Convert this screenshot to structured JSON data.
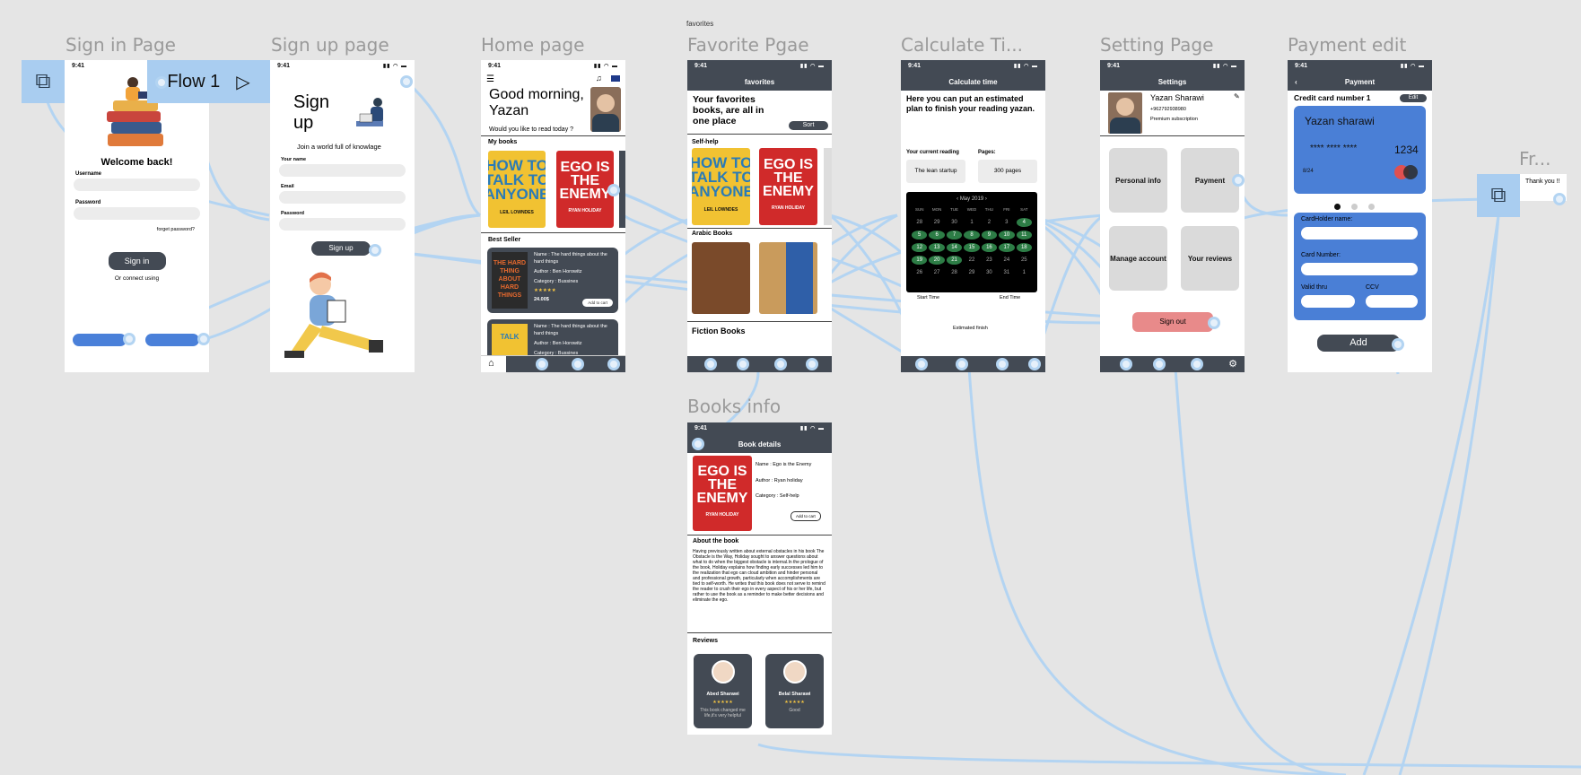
{
  "canvas": {
    "top_label": "favorites",
    "flow_name": "Flow 1"
  },
  "frames": {
    "signin": "Sign in Page",
    "signup": "Sign up page",
    "home": "Home page",
    "favorite": "Favorite Pgae",
    "calculate": "Calculate Ti...",
    "settings": "Setting Page",
    "payment": "Payment edit",
    "books_info": "Books info",
    "fr": "Fr..."
  },
  "status_time": "9:41",
  "signin": {
    "welcome": "Welcome back!",
    "username_label": "Username",
    "password_label": "Password",
    "forgot": "forget password?",
    "signin_button": "Sign in",
    "connect": "Or connect using"
  },
  "signup": {
    "title": "Sign up",
    "subtitle": "Join a world full of knowlage",
    "name_label": "Your name",
    "email_label": "Email",
    "password_label": "Password",
    "signup_button": "Sign up"
  },
  "home": {
    "greeting": "Good morning, Yazan",
    "question": "Would you like to read  today ?",
    "my_books": "My books",
    "best_seller": "Best Seller",
    "item1": {
      "name": "Name : The hard things about the hard things",
      "author": "Author : Ben Horowitz",
      "category": "Category : Bussines",
      "price": "24.00$",
      "add": "Add to cart",
      "stars": "★★★★★"
    },
    "item2": {
      "name": "Name : The hard things about the hard things",
      "author": "Author : Ben Horowitz",
      "category": "Category : Bussines"
    }
  },
  "books": {
    "how_to_talk": {
      "title": "HOW TO TALK TO ANYONE",
      "author": "LEIL LOWNDES"
    },
    "ego": {
      "title": "EGO IS THE ENEMY",
      "author": "RYAN HOLIDAY"
    },
    "hard_things": {
      "title": "THE HARD THING ABOUT HARD THINGS"
    }
  },
  "favorite": {
    "header": "favorites",
    "headline": "Your favorites books, are all in one place",
    "sort": "Sort",
    "self_help": "Self-help",
    "arabic": "Arabic Books",
    "fiction": "Fiction Books"
  },
  "calculate": {
    "header": "Calculate time",
    "intro": "Here you can put an estimated plan to finish your reading yazan.",
    "current_label": "Your current reading",
    "current_value": "The lean startup",
    "pages_label": "Pages:",
    "pages_value": "300 pages",
    "month": "May 2019",
    "weekdays": [
      "SUN",
      "MON",
      "TUE",
      "WED",
      "THU",
      "FRI",
      "SAT"
    ],
    "days": [
      "28",
      "29",
      "30",
      "1",
      "2",
      "3",
      "4",
      "5",
      "6",
      "7",
      "8",
      "9",
      "10",
      "11",
      "12",
      "13",
      "14",
      "15",
      "16",
      "17",
      "18",
      "19",
      "20",
      "21",
      "22",
      "23",
      "24",
      "25",
      "26",
      "27",
      "28",
      "29",
      "30",
      "31",
      "1"
    ],
    "start": "Start Time",
    "end": "End Time",
    "estimated": "Estimated finish"
  },
  "settings": {
    "header": "Settings",
    "name": "Yazan Sharawi",
    "phone": "+962792938980",
    "subscription": "Premium subscription",
    "tiles": [
      "Personal info",
      "Payment",
      "Manage account",
      "Your reviews"
    ],
    "signout": "Sign out"
  },
  "payment": {
    "header": "Payment",
    "card_title": "Credit card number 1",
    "edit": "Edit",
    "holder": "Yazan sharawi",
    "masked": "**** **** ****",
    "last4": "1234",
    "expiry": "8/24",
    "holder_label": "CardHolder name:",
    "number_label": "Card Number:",
    "valid_label": "Valid thru",
    "ccv_label": "CCV",
    "add": "Add"
  },
  "books_info": {
    "header": "Book details",
    "name": "Name : Ego is the Enemy",
    "author": "Author : Ryan holiday",
    "category": "Category : Self-help",
    "add": "Add to cart",
    "about_title": "About the book",
    "about": "Having previously written about external obstacles in his book The Obstacle is the Way, Holiday sought to answer questions about what to do when the biggest obstacle is internal.In the prologue of the book, Holiday explains how finding early successes led him to the realization that ego can cloud ambition and hinder personal and professional growth, particularly when accomplishments are tied to self-worth. He writes that this book does not serve to remind the reader to crush their ego in every aspect of his or her life, but rather to use the book as a reminder to make better decisions and eliminate the ego.",
    "reviews_title": "Reviews",
    "review1": {
      "name": "Abed Sharawi",
      "stars": "★★★★★",
      "text": "This book changed me life,it's very helpful"
    },
    "review2": {
      "name": "Belal Sharawi",
      "stars": "★★★★★",
      "text": "Good"
    }
  },
  "thanks": "Thank you !!"
}
